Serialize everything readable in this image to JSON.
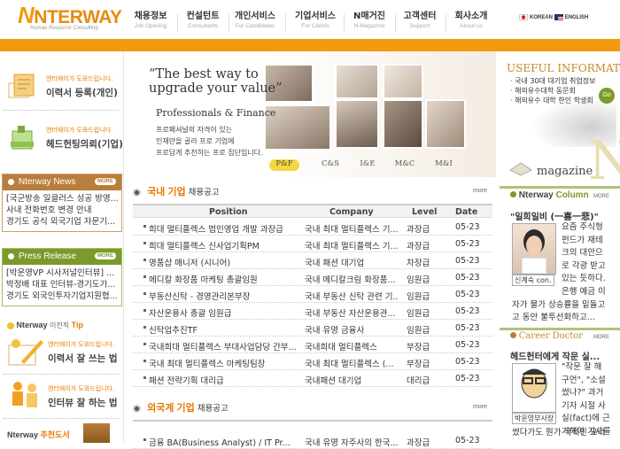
{
  "header": {
    "logo_main": "NTERWAY",
    "logo_first": "N",
    "logo_sub": "Human Resource Consulting",
    "nav": [
      {
        "ko": "채용정보",
        "en": "Job Opening"
      },
      {
        "ko": "컨설턴트",
        "en": "Consultants"
      },
      {
        "ko": "개인서비스",
        "en": "For Candidates"
      },
      {
        "ko": "기업서비스",
        "en": "For Clients"
      },
      {
        "ko": "N매거진",
        "en": "N-Magazine"
      },
      {
        "ko": "고객센터",
        "en": "Support"
      },
      {
        "ko": "회사소개",
        "en": "About us"
      }
    ],
    "lang_korean": "KOREAN",
    "lang_english": "ENGLISH"
  },
  "left": {
    "resume": {
      "small": "엔터웨이가 도와드립니다.",
      "big": "이력서 등록(개인)"
    },
    "headhunt": {
      "small": "엔터웨이가 도와드립니다.",
      "big": "헤드헌팅의뢰(기업)"
    },
    "news": {
      "title": "Nterway News",
      "more": "MORE",
      "items": [
        "[국군방송 일클러스 성공 방영...",
        "사내 전화번호 변경 안내",
        "경기도 공식 외국기업 자문기..."
      ]
    },
    "press": {
      "title": "Press Release",
      "more": "MORE",
      "items": [
        "[박운영VP 시사저널인터뷰] ...",
        "박정배 대표 인터뷰-경기도가...",
        "경기도 외국인투자기업지원협..."
      ]
    },
    "tip": {
      "brand": "Nterway",
      "label": "이전직",
      "accent": "Tip"
    },
    "tip1": {
      "small": "엔터웨이가 도와드립니다.",
      "big": "이력서 잘 쓰는 법"
    },
    "tip2": {
      "small": "엔터웨이가 도와드립니다.",
      "big": "인터뷰 잘 하는 법"
    },
    "bottom": {
      "brand": "Nterway",
      "accent": "추천도서"
    }
  },
  "banner": {
    "line1": "“The best way to",
    "line2": "upgrade your value”",
    "sub": "Professionals & Finance",
    "desc": [
      "프로페셔널의 자격이 있는",
      "인재만을 골라 프로 기업에",
      "프로답게 추천하는 프로 집단입니다."
    ],
    "tabs": [
      "P&F",
      "C&S",
      "I&E",
      "M&C",
      "M&I"
    ],
    "active_tab": "P&F"
  },
  "right": {
    "useful_title": "USEFUL INFORMATION",
    "useful_items": [
      "· 국내 30대 대기업 취업정보",
      "· 해외유수대학 동문회",
      "· 해외유수 대학 한인 학생회"
    ],
    "go": "Go",
    "magazine": "magazine",
    "column": {
      "brand": "Nterway",
      "accent": "Column",
      "more": "MORE",
      "quote": "\"일희일비 (一喜一悲)\"",
      "lines": [
        "요즘 주식형",
        "펀드가 재테",
        "크의 대안으",
        "로 각광 받고",
        "있는 듯하다.",
        "은행 예금 이",
        "자가 물가 상승률을 밑돌고",
        "고 동안 불투선화하고..."
      ],
      "caption": "신계숙 con."
    },
    "career": {
      "brand": "Career",
      "accent": "Doctor",
      "more": "MORE",
      "headline": "헤드헌터에게 작문 실...",
      "lines": [
        "\"작문 잘 해",
        "구먼\", \"소설",
        "썼나?\" 과거",
        "기자 시절 사",
        "실(fact)에 근",
        "거해야 기사를",
        "썼다가도 뭔가 극적인 요라"
      ],
      "caption": "박운영부사장"
    }
  },
  "domestic": {
    "title_a": "국내 기업",
    "title_b": "채용공고",
    "more": "more",
    "headers": [
      "Position",
      "Company",
      "Level",
      "Date"
    ],
    "rows": [
      [
        "희대 멀티플렉스 법인영업 개발 과장급",
        "국내 최대 멀티플렉스 기...",
        "과장급",
        "05-23"
      ],
      [
        "희대 멀티플렉스 신사업기획PM",
        "국내 최대 멀티플렉스 기...",
        "과장급",
        "05-23"
      ],
      [
        "명품샵 매니저 (시니어)",
        "국내 패션 대기업",
        "차장급",
        "05-23"
      ],
      [
        "메디칼 화장품 마케팅 총괄임원",
        "국내 메디칼크림 화장품...",
        "임원급",
        "05-23"
      ],
      [
        "부동산신탁 - 경영관리본부장",
        "국내 부동산 신탁 관련 기...",
        "임원급",
        "05-23"
      ],
      [
        "자산운용사 총괄 임원급",
        "국내 부동산 자산운용관...",
        "임원급",
        "05-23"
      ],
      [
        "신탁업추진TF",
        "국내 유명 금융사",
        "임원급",
        "05-23"
      ],
      [
        "국내희대 멀티플렉스 부대사업담당 간부...",
        "국내희대 멀티플렉스",
        "부장급",
        "05-23"
      ],
      [
        "국내 최대 멀티플렉스 마케팅팀장",
        "국내 최대 멀티플렉스 (...",
        "부장급",
        "05-23"
      ],
      [
        "패션 전략기획 대리급",
        "국내패션 대기업",
        "대리급",
        "05-23"
      ]
    ]
  },
  "foreign": {
    "title_a": "외국계 기업",
    "title_b": "채용공고",
    "more": "more",
    "rows": [
      [
        "금융 BA(Business Analyst) / IT Pr...",
        "국내 유명 자주사의 한국...",
        "과장급",
        "05-23"
      ]
    ]
  },
  "colors": {
    "accent": "#f29a10",
    "olive": "#7b9a2c",
    "brown": "#b97e3c"
  }
}
